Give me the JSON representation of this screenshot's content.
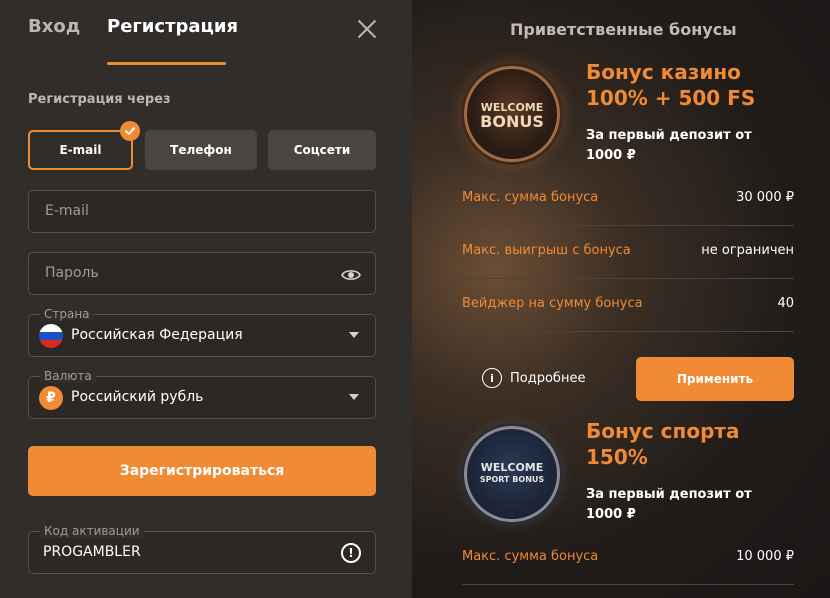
{
  "auth": {
    "tabs": {
      "login": "Вход",
      "register": "Регистрация"
    },
    "via_label": "Регистрация через",
    "methods": {
      "email": "E-mail",
      "phone": "Телефон",
      "social": "Соцсети"
    },
    "email_placeholder": "E-mail",
    "password_placeholder": "Пароль",
    "country": {
      "label": "Страна",
      "value": "Российская Федерация"
    },
    "currency": {
      "label": "Валюта",
      "value": "Российский рубль",
      "symbol": "₽"
    },
    "register_button": "Зарегистрироваться",
    "activation": {
      "label": "Код активации",
      "value": "PROGAMBLER",
      "info_glyph": "!"
    },
    "colors": {
      "accent": "#f08a34",
      "panel": "#312d2b"
    }
  },
  "bonuses": {
    "title": "Приветственные бонусы",
    "casino": {
      "coin_line1": "WELCOME",
      "coin_line2": "BONUS",
      "name_line1": "Бонус казино",
      "name_line2": "100% + 500 FS",
      "deposit_line1": "За первый депозит от",
      "deposit_line2": "1000 ₽",
      "rows": [
        {
          "label": "Макс. сумма бонуса",
          "value": "30 000 ₽"
        },
        {
          "label": "Макс. выигрыш с бонуса",
          "value": "не ограничен"
        },
        {
          "label": "Вейджер на сумму бонуса",
          "value": "40"
        }
      ],
      "more_label": "Подробнее",
      "more_glyph": "i",
      "apply_label": "Применить"
    },
    "sport": {
      "coin_line1": "WELCOME",
      "coin_line2": "SPORT BONUS",
      "name_line1": "Бонус спорта",
      "name_line2": "150%",
      "deposit_line1": "За первый депозит от",
      "deposit_line2": "1000 ₽",
      "rows": [
        {
          "label": "Макс. сумма бонуса",
          "value": "10 000 ₽"
        }
      ]
    }
  }
}
